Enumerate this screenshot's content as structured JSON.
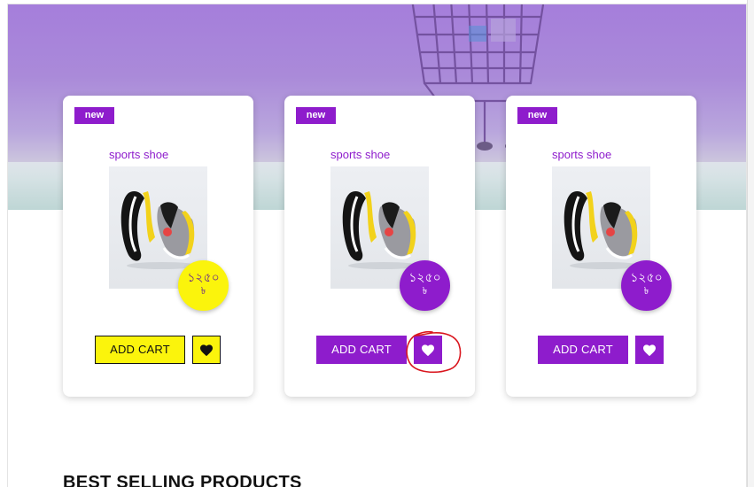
{
  "products": [
    {
      "badge": "new",
      "title": "sports shoe",
      "price": "১২৫০",
      "currency": "৳",
      "add_cart_label": "ADD CART",
      "theme": "yellow",
      "wishlist_icon": "heart-icon"
    },
    {
      "badge": "new",
      "title": "sports shoe",
      "price": "১২৫০",
      "currency": "৳",
      "add_cart_label": "ADD CART",
      "theme": "purple",
      "wishlist_icon": "heart-icon",
      "annotated": true
    },
    {
      "badge": "new",
      "title": "sports shoe",
      "price": "১২৫০",
      "currency": "৳",
      "add_cart_label": "ADD CART",
      "theme": "purple",
      "wishlist_icon": "heart-icon"
    }
  ],
  "section": {
    "title": "BEST SELLING PRODUCTS"
  },
  "colors": {
    "accent": "#8e1ccc",
    "highlight": "#fbf40c",
    "annotation": "#d9161e"
  },
  "hero": {
    "image": "shopping-cart-photo"
  }
}
